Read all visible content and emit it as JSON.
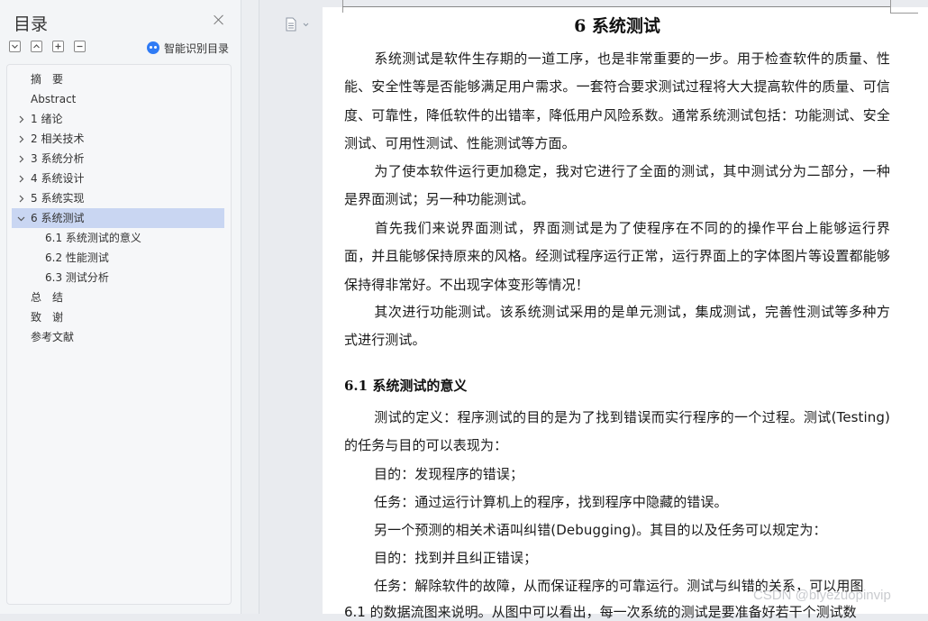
{
  "sidebar": {
    "title": "目录",
    "smart_toc_label": "智能识别目录",
    "items": [
      {
        "label": "摘　要",
        "level": 0,
        "arrow": ""
      },
      {
        "label": "Abstract",
        "level": 0,
        "arrow": ""
      },
      {
        "label": "1 绪论",
        "level": 0,
        "arrow": "right"
      },
      {
        "label": "2 相关技术",
        "level": 0,
        "arrow": "right"
      },
      {
        "label": "3 系统分析",
        "level": 0,
        "arrow": "right"
      },
      {
        "label": "4 系统设计",
        "level": 0,
        "arrow": "right"
      },
      {
        "label": "5 系统实现",
        "level": 0,
        "arrow": "right"
      },
      {
        "label": "6 系统测试",
        "level": 0,
        "arrow": "down",
        "active": true
      },
      {
        "label": "6.1 系统测试的意义",
        "level": 1,
        "arrow": ""
      },
      {
        "label": "6.2 性能测试",
        "level": 1,
        "arrow": ""
      },
      {
        "label": "6.3 测试分析",
        "level": 1,
        "arrow": ""
      },
      {
        "label": "总　结",
        "level": 0,
        "arrow": ""
      },
      {
        "label": "致　谢",
        "level": 0,
        "arrow": ""
      },
      {
        "label": "参考文献",
        "level": 0,
        "arrow": ""
      }
    ]
  },
  "document": {
    "heading": "6 系统测试",
    "p1": "系统测试是软件生存期的一道工序，也是非常重要的一步。用于检查软件的质量、性能、安全性等是否能够满足用户需求。一套符合要求测试过程将大大提高软件的质量、可信度、可靠性，降低软件的出错率，降低用户风险系数。通常系统测试包括：功能测试、安全测试、可用性测试、性能测试等方面。",
    "p2": "为了使本软件运行更加稳定，我对它进行了全面的测试，其中测试分为二部分，一种是界面测试；另一种功能测试。",
    "p3": "首先我们来说界面测试，界面测试是为了使程序在不同的的操作平台上能够运行界面，并且能够保持原来的风格。经测试程序运行正常，运行界面上的字体图片等设置都能够保持得非常好。不出现字体变形等情况！",
    "p4": "其次进行功能测试。该系统测试采用的是单元测试，集成测试，完善性测试等多种方式进行测试。",
    "section": "6.1 系统测试的意义",
    "p5": "测试的定义：程序测试的目的是为了找到错误而实行程序的一个过程。测试(Testing)的任务与目的可以表现为：",
    "p6": "目的：发现程序的错误；",
    "p7": "任务：通过运行计算机上的程序，找到程序中隐藏的错误。",
    "p8": "另一个预测的相关术语叫纠错(Debugging)。其目的以及任务可以规定为：",
    "p9": "目的：找到并且纠正错误；",
    "p10": "任务：解除软件的故障，从而保证程序的可靠运行。测试与纠错的关系，可以用图",
    "p11": "6.1 的数据流图来说明。从图中可以看出，每一次系统的测试是要准备好若干个测试数"
  },
  "watermark": "CSDN @biyezuopinvip"
}
